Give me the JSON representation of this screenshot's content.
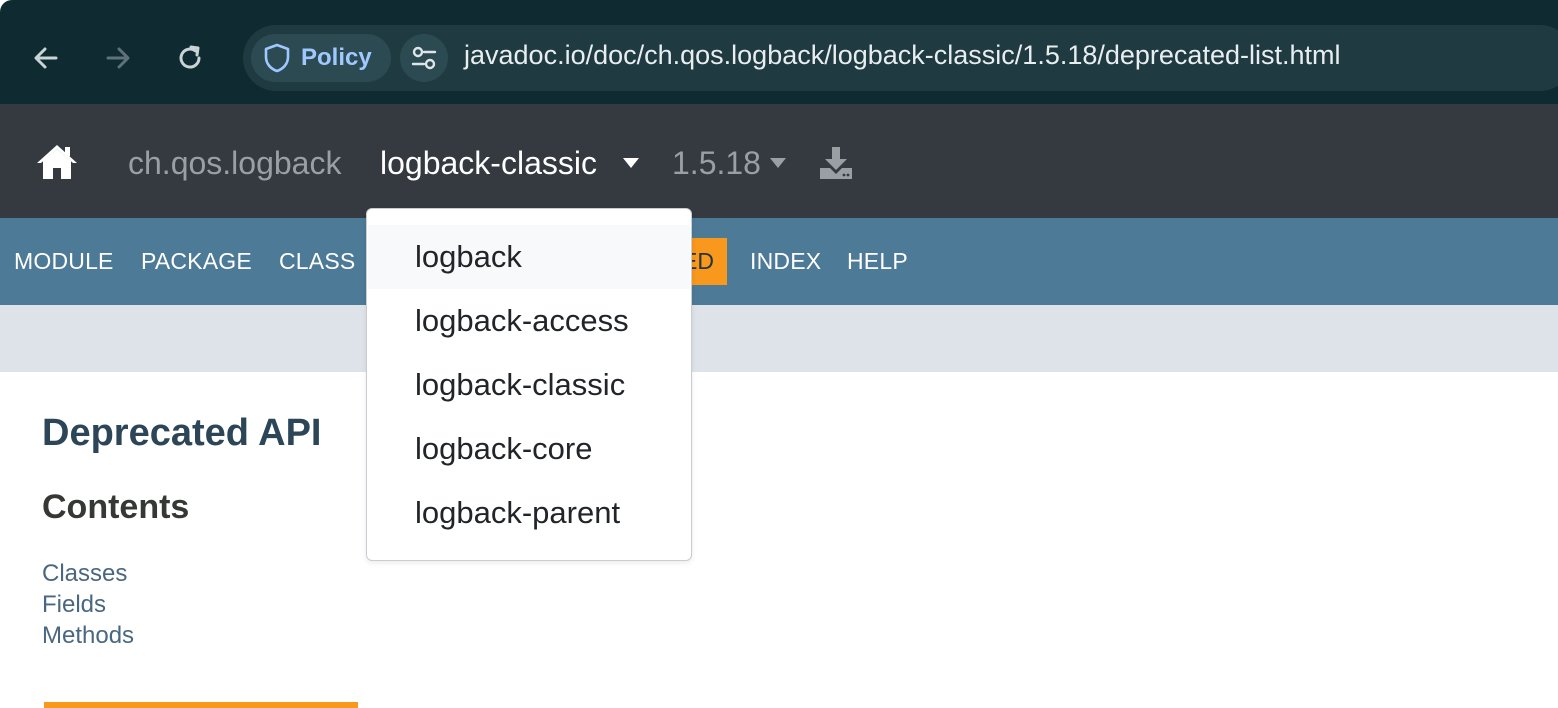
{
  "browser": {
    "policy_label": "Policy",
    "url": "javadoc.io/doc/ch.qos.logback/logback-classic/1.5.18/deprecated-list.html"
  },
  "header": {
    "group": "ch.qos.logback",
    "artifact": "logback-classic",
    "version": "1.5.18"
  },
  "javadoc_nav": {
    "module": "MODULE",
    "package": "PACKAGE",
    "class": "CLASS",
    "deprecated_visible": "ED",
    "index": "INDEX",
    "help": "HELP"
  },
  "main": {
    "title": "Deprecated API",
    "contents_heading": "Contents",
    "contents_links": [
      "Classes",
      "Fields",
      "Methods"
    ]
  },
  "artifact_dropdown": {
    "items": [
      "logback",
      "logback-access",
      "logback-classic",
      "logback-core",
      "logback-parent"
    ]
  },
  "colors": {
    "nav_bar": "#4d7a97",
    "accent": "#f8981d",
    "header": "#343a40",
    "link": "#4a6782"
  }
}
